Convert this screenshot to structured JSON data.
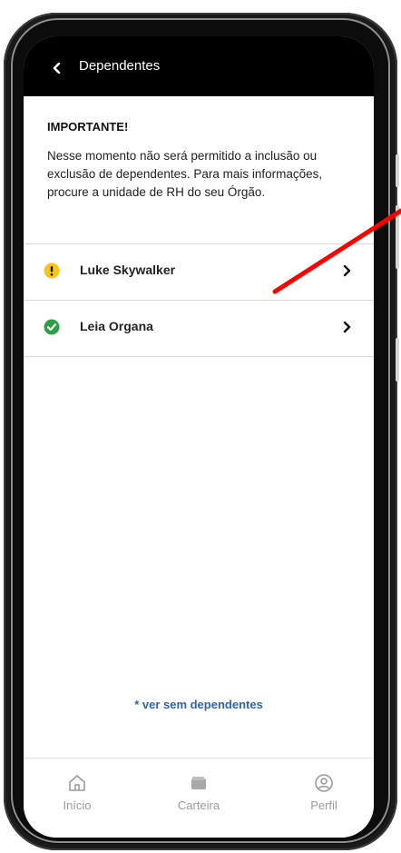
{
  "header": {
    "title": "Dependentes"
  },
  "notice": {
    "title": "IMPORTANTE!",
    "text": "Nesse momento não será permitido a inclusão ou exclusão de dependentes. Para mais informações, procure a unidade de RH do seu Órgão."
  },
  "dependents": [
    {
      "name": "Luke Skywalker",
      "status": "warning",
      "status_color": "#f5c518"
    },
    {
      "name": "Leia Organa",
      "status": "ok",
      "status_color": "#2e9e47"
    }
  ],
  "link": {
    "label": "* ver sem dependentes"
  },
  "bottom_nav": {
    "items": [
      {
        "label": "Início",
        "icon": "home-icon"
      },
      {
        "label": "Carteira",
        "icon": "wallet-icon"
      },
      {
        "label": "Perfil",
        "icon": "profile-icon"
      }
    ]
  },
  "annotation": {
    "color": "#ff0000"
  }
}
